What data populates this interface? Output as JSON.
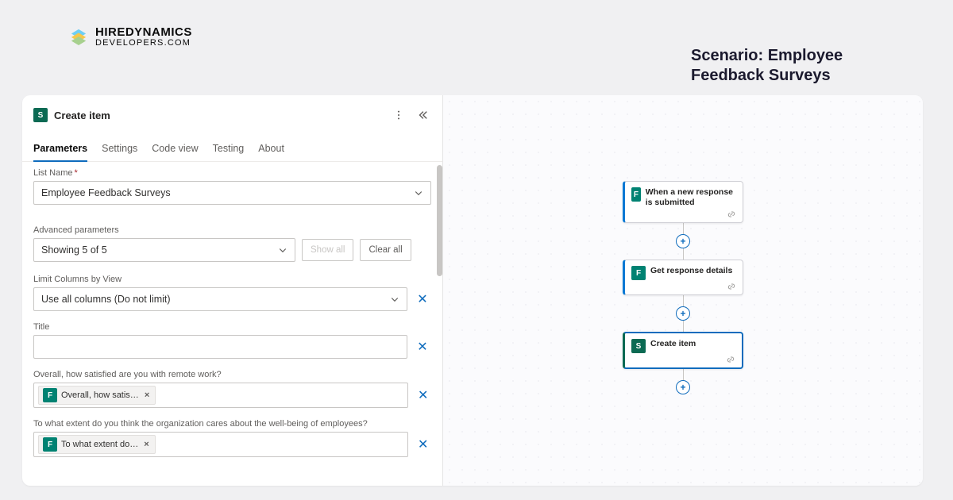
{
  "brand": {
    "line1": "HIREDYNAMICS",
    "line2": "DEVELOPERS.COM"
  },
  "scenario": "Scenario: Employee Feedback Surveys",
  "panel": {
    "title": "Create item",
    "tabs": [
      "Parameters",
      "Settings",
      "Code view",
      "Testing",
      "About"
    ],
    "active_tab": 0,
    "list_name_label": "List Name",
    "list_name_value": "Employee Feedback Surveys",
    "adv_label": "Advanced parameters",
    "adv_value": "Showing 5 of 5",
    "show_all": "Show all",
    "clear_all": "Clear all",
    "limit_label": "Limit Columns by View",
    "limit_value": "Use all columns (Do not limit)",
    "title_label": "Title",
    "title_value": "",
    "q1_label": "Overall, how satisfied are you with remote work?",
    "q1_token": "Overall, how satis…",
    "q2_label": "To what extent do you think the organization cares about the well-being of employees?",
    "q2_token": "To what extent do…"
  },
  "flow": {
    "n1": "When a new response is submitted",
    "n2": "Get response details",
    "n3": "Create item"
  }
}
